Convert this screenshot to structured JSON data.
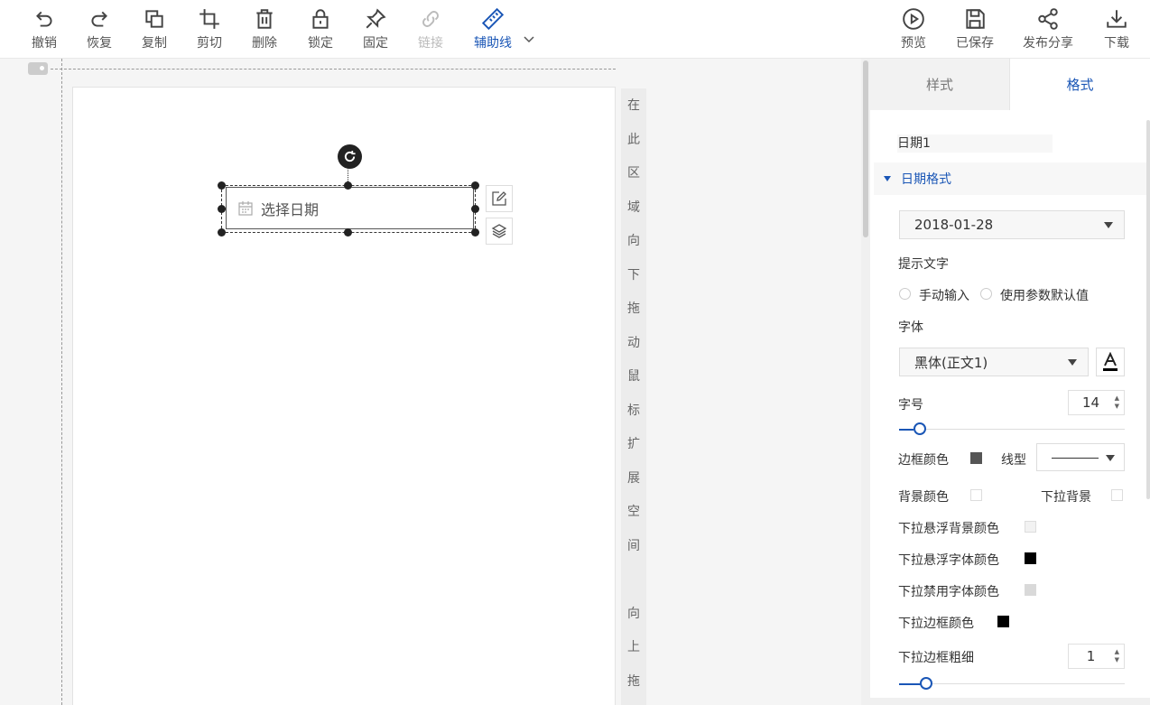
{
  "toolbar": {
    "undo": "撤销",
    "redo": "恢复",
    "copy": "复制",
    "cut": "剪切",
    "delete": "删除",
    "lock": "锁定",
    "pin": "固定",
    "link": "链接",
    "guides": "辅助线",
    "preview": "预览",
    "saved": "已保存",
    "share": "发布分享",
    "download": "下载"
  },
  "canvas": {
    "widget_placeholder": "选择日期",
    "expand_hint": [
      "在",
      "此",
      "区",
      "域",
      "向",
      "下",
      "拖",
      "动",
      "鼠",
      "标",
      "扩",
      "展",
      "空",
      "间"
    ],
    "drag_up_hint": [
      "向",
      "上",
      "拖"
    ]
  },
  "panel": {
    "tabs": [
      "样式",
      "格式"
    ],
    "active_tab": "格式",
    "widget_name": "日期1",
    "section_date_format": "日期格式",
    "date_format_value": "2018-01-28",
    "hint_text_label": "提示文字",
    "radio_manual": "手动输入",
    "radio_param_default": "使用参数默认值",
    "font_label": "字体",
    "font_value": "黑体(正文1)",
    "font_size_label": "字号",
    "font_size_value": "14",
    "border_color_label": "边框颜色",
    "line_type_label": "线型",
    "bg_color_label": "背景颜色",
    "dropdown_bg_label": "下拉背景",
    "dropdown_hover_bg_label": "下拉悬浮背景颜色",
    "dropdown_hover_font_label": "下拉悬浮字体颜色",
    "dropdown_disabled_font_label": "下拉禁用字体颜色",
    "dropdown_border_color_label": "下拉边框颜色",
    "dropdown_border_width_label": "下拉边框粗细",
    "dropdown_border_width_value": "1"
  },
  "colors": {
    "accent": "#1a56b6",
    "border_color": "#555555",
    "bg_color": "#ffffff",
    "dropdown_bg": "#ffffff",
    "dropdown_hover_bg": "#f2f2f2",
    "dropdown_hover_font": "#000000",
    "dropdown_disabled_font": "#d9d9d9",
    "dropdown_border_color": "#000000"
  }
}
